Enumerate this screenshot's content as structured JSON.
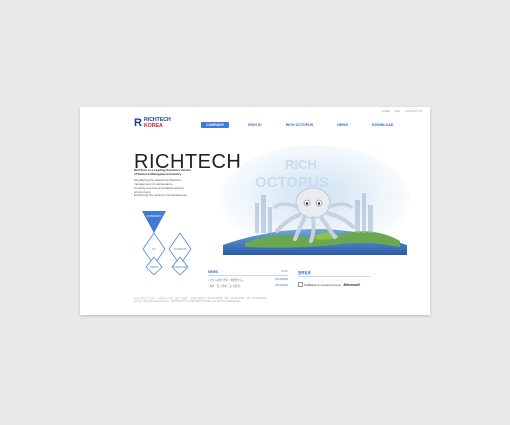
{
  "util_links": [
    "HOME",
    "MAP",
    "CONTACT US"
  ],
  "logo": {
    "mark": "R",
    "line1": "RICHTECH",
    "line2": "KOREA"
  },
  "nav": {
    "items": [
      "COMPANY",
      "RICH IO",
      "RICH OCTOPUS",
      "NEWS",
      "DOWNLOAD"
    ]
  },
  "hero_title": "RICHTECH",
  "intro": {
    "line1": "RichTech is a Leading Solutions Vendor",
    "line2": "of Network Management Industry",
    "line3": "Simplifying the network architecture",
    "line4": "management & maintenance",
    "line5": "Creating a secure and stable network environment",
    "line6": "Enhancing the network competitiveness"
  },
  "diamonds": [
    "COMPANY",
    "IO",
    "OCTOPUS",
    "NEWS",
    "DOWNLOAD"
  ],
  "hero_image": {
    "text1": "RICH",
    "text2": "OCTOPUS"
  },
  "news": {
    "title": "NEWS",
    "more": "MORE",
    "rows": [
      {
        "title": "• 보호 시장의 변화 · 해결방안 등...",
        "date": "2013/08/20"
      },
      {
        "title": "• 제휴 · 업그레이드 및 안정화...",
        "date": "2013/08/20"
      }
    ]
  },
  "partner": {
    "title": "협력업체",
    "name": "SoftBank Commerce Korea",
    "logo": "Microsoft"
  },
  "footer": {
    "line1": "서울시 강남구 논현동 · 리치테크코리아 · 대표 : 홍길동 · 사업자등록번호 : 000-00-00000 · TEL : 02-000-0000 · FAX : 02-000-0000",
    "line2": "E-mail : info@richtechkorea.com · COPYRIGHT (C) RICHTECH KOREA. ALL RIGHTS RESERVED."
  },
  "colors": {
    "accent": "#3e7ad6",
    "brand_blue": "#1c3a8c",
    "brand_red": "#c81f2c"
  }
}
